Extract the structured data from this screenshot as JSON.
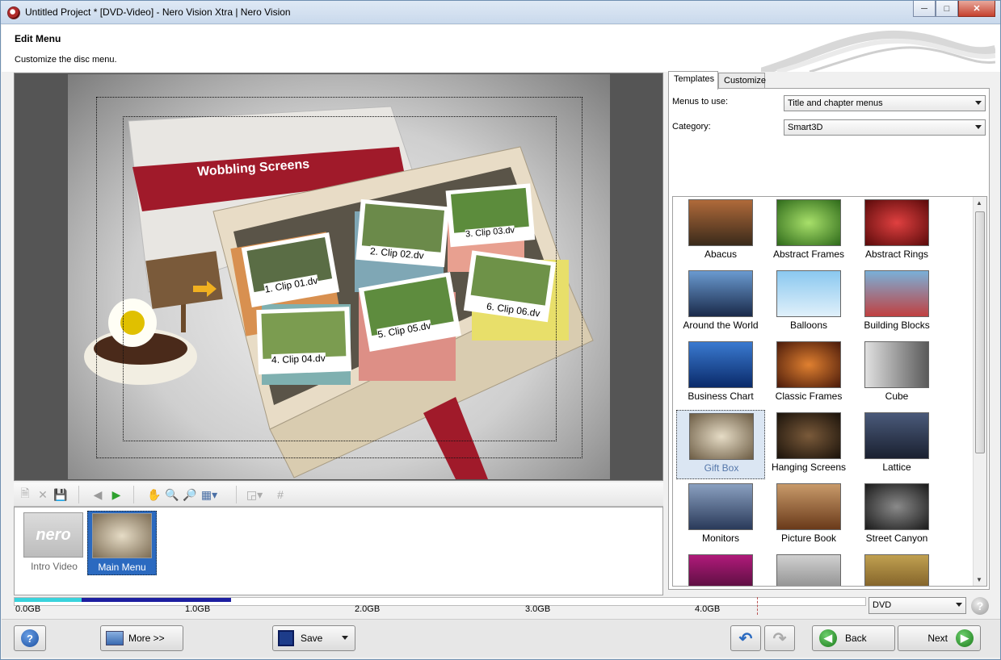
{
  "window": {
    "title": "Untitled Project * [DVD-Video] - Nero Vision Xtra | Nero Vision",
    "controls": [
      "minimize",
      "maximize",
      "close"
    ]
  },
  "header": {
    "title": "Edit Menu",
    "subtitle": "Customize the disc menu."
  },
  "preview": {
    "menu_title": "Wobbling Screens",
    "clips": [
      "1. Clip 01.dv",
      "2. Clip 02.dv",
      "3. Clip 03.dv",
      "4. Clip 04.dv",
      "5. Clip 05.dv",
      "6. Clip 06.dv"
    ]
  },
  "preview_toolbar": {
    "icons": [
      "new-icon",
      "delete-icon",
      "save-icon",
      "back-icon",
      "forward-icon",
      "hand-icon",
      "zoom-in-icon",
      "zoom-out-icon",
      "layout-icon",
      "arrange-icon",
      "grid-icon"
    ]
  },
  "strip": {
    "items": [
      {
        "label": "Intro Video",
        "thumb_text": "nero"
      },
      {
        "label": "Main Menu",
        "selected": true
      }
    ]
  },
  "right_panel": {
    "tabs": [
      "Templates",
      "Customize"
    ],
    "menus_to_use_label": "Menus to use:",
    "menus_to_use_value": "Title and chapter menus",
    "category_label": "Category:",
    "category_value": "Smart3D",
    "templates": [
      "Abacus",
      "Abstract Frames",
      "Abstract Rings",
      "Around the World",
      "Balloons",
      "Building Blocks",
      "Business Chart",
      "Classic Frames",
      "Cube",
      "Gift Box",
      "Hanging Screens",
      "Lattice",
      "Monitors",
      "Picture Book",
      "Street Canyon"
    ],
    "selected_template": "Gift Box"
  },
  "capacity": {
    "labels": [
      "0.0GB",
      "1.0GB",
      "2.0GB",
      "3.0GB",
      "4.0GB"
    ],
    "disc_type": "DVD"
  },
  "bottom": {
    "help": "?",
    "more": "More >>",
    "save": "Save",
    "back": "Back",
    "next": "Next"
  },
  "colors": {
    "selection": "#2b6ac0",
    "capacity_used_1": "#39d3dc",
    "capacity_used_2": "#1d1fa0",
    "back_next_green": "#2ea12e"
  }
}
